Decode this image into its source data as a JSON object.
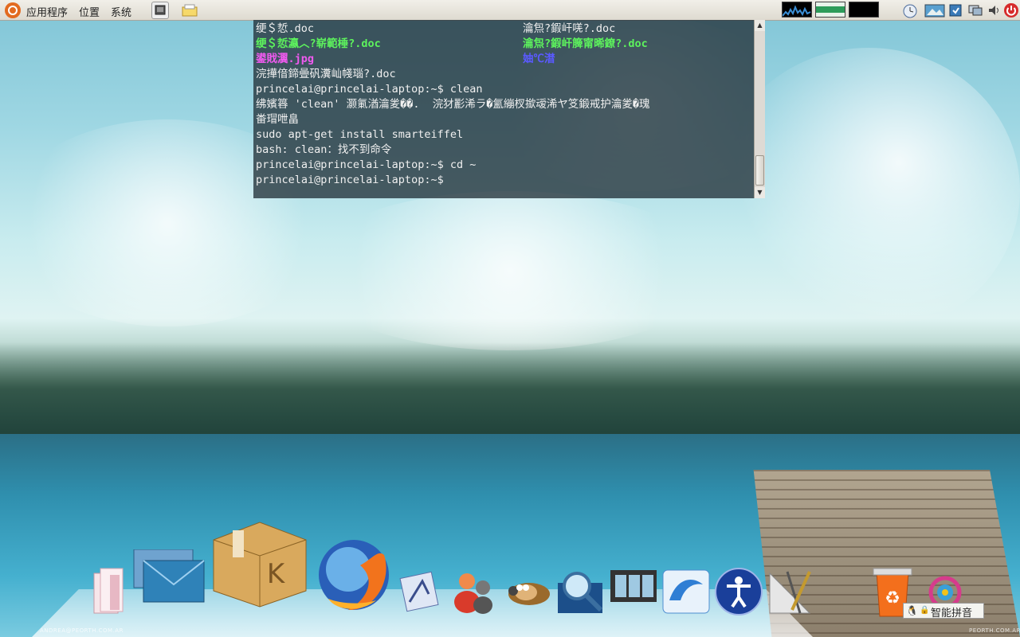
{
  "panel": {
    "menus": [
      "应用程序",
      "位置",
      "系统"
    ]
  },
  "terminal": {
    "lines": [
      {
        "col1": "绠＄悊.doc",
        "col2": "瀹炰?鍜屽唴?.doc"
      },
      {
        "col1": "绠＄悊瀛︿?崭範棰?.doc",
        "col2": "瀹炰?鍜屽簲甯晞鐐?.doc",
        "style": "green"
      },
      {
        "col1": "鍙戝瀷.jpg",
        "col2": "妯℃澘",
        "col1_style": "magenta",
        "col2_style": "blue"
      },
      {
        "col1": "浣撶偣鍗曡矾瀵屾帴瑙?.doc"
      },
      {
        "col1": "princelai@princelai-laptop:~$ clean"
      },
      {
        "col1": "绋嬪簭 'clean' 灏氭湭瀹夎��.  浣犲彲浠ラ�氳繃杈撳叆浠ヤ笅鍛戒护瀹夎�瑰"
      },
      {
        "col1": "畨瑁呭畠"
      },
      {
        "col1": "sudo apt-get install smarteiffel"
      },
      {
        "col1": "bash: clean：找不到命令"
      },
      {
        "col1": "princelai@princelai-laptop:~$ cd ~"
      },
      {
        "col1": "princelai@princelai-laptop:~$"
      }
    ]
  },
  "dock": {
    "icons": [
      "files-icon",
      "mail-icon",
      "package-icon",
      "firefox-icon",
      "mail-client-icon",
      "chat-icon",
      "gimp-icon",
      "search-icon",
      "video-icon",
      "office-icon",
      "accessibility-icon",
      "geometry-icon",
      "trash-icon",
      "settings-icon"
    ]
  },
  "ime": {
    "label": "智能拼音"
  },
  "watermarks": {
    "left": "ANDREA@PEORTH.COM.AR",
    "right": "PEORTH.COM.AR"
  },
  "colors": {
    "terminal_bg": "#24323a",
    "prompt_green": "#5df25d",
    "magenta": "#f05af0",
    "blue": "#5a5aff"
  }
}
